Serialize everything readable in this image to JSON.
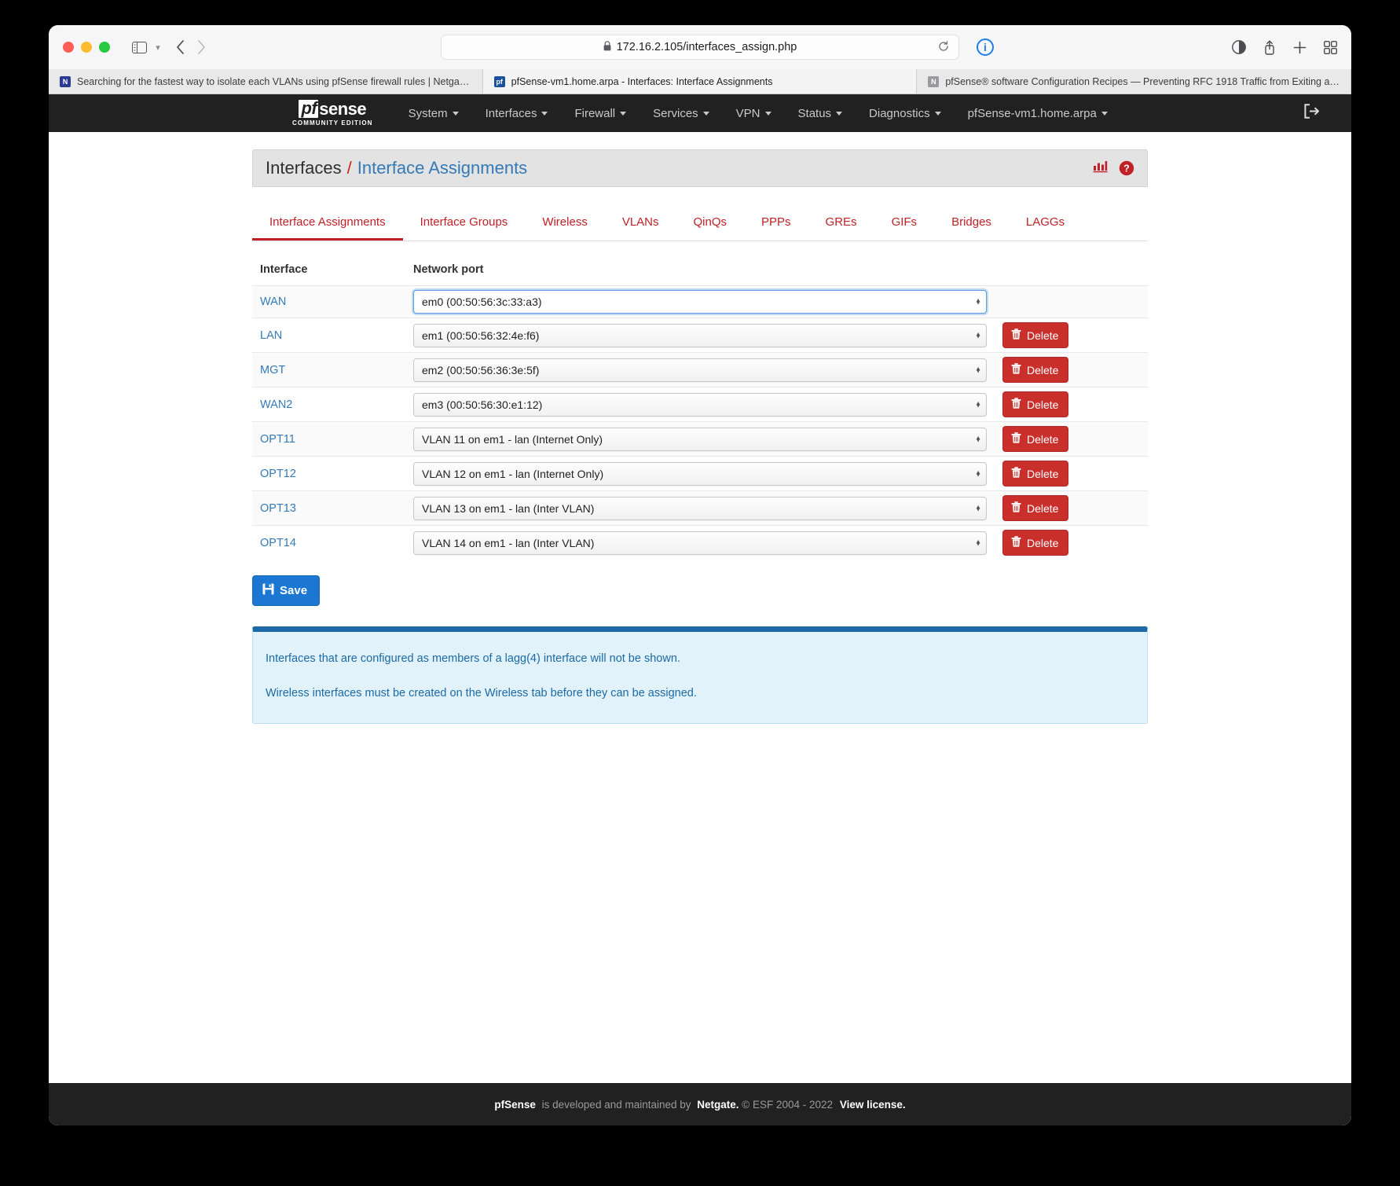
{
  "browser": {
    "url": "172.16.2.105/interfaces_assign.php",
    "lock_icon": "lock-icon",
    "reload_icon": "reload-icon",
    "info_badge": "i",
    "tabs": [
      {
        "title": "Searching for the fastest way to isolate each VLANs using pfSense firewall rules | Netgate For...",
        "favicon": "netgate-icon",
        "active": false
      },
      {
        "title": "pfSense-vm1.home.arpa - Interfaces: Interface Assignments",
        "favicon": "pfsense-icon",
        "active": true
      },
      {
        "title": "pfSense® software Configuration Recipes — Preventing RFC 1918 Traffic from Exiting a WAN I...",
        "favicon": "docs-icon",
        "active": false
      }
    ]
  },
  "navbar": {
    "brand": {
      "pf": "pf",
      "sense": "sense",
      "subtitle": "COMMUNITY EDITION"
    },
    "items": [
      {
        "label": "System",
        "has_caret": true
      },
      {
        "label": "Interfaces",
        "has_caret": true
      },
      {
        "label": "Firewall",
        "has_caret": true
      },
      {
        "label": "Services",
        "has_caret": true
      },
      {
        "label": "VPN",
        "has_caret": true
      },
      {
        "label": "Status",
        "has_caret": true
      },
      {
        "label": "Diagnostics",
        "has_caret": true
      },
      {
        "label": "pfSense-vm1.home.arpa",
        "has_caret": true
      }
    ],
    "logout_icon": "logout-icon"
  },
  "header": {
    "root": "Interfaces",
    "separator": "/",
    "leaf": "Interface Assignments",
    "chart_icon": "bar-chart-icon",
    "help_icon": "help-circle-icon"
  },
  "tabs": [
    {
      "label": "Interface Assignments",
      "active": true
    },
    {
      "label": "Interface Groups",
      "active": false
    },
    {
      "label": "Wireless",
      "active": false
    },
    {
      "label": "VLANs",
      "active": false
    },
    {
      "label": "QinQs",
      "active": false
    },
    {
      "label": "PPPs",
      "active": false
    },
    {
      "label": "GREs",
      "active": false
    },
    {
      "label": "GIFs",
      "active": false
    },
    {
      "label": "Bridges",
      "active": false
    },
    {
      "label": "LAGGs",
      "active": false
    }
  ],
  "table": {
    "columns": [
      "Interface",
      "Network port"
    ],
    "rows": [
      {
        "interface": "WAN",
        "port": "em0 (00:50:56:3c:33:a3)",
        "deletable": false,
        "focused": true
      },
      {
        "interface": "LAN",
        "port": "em1 (00:50:56:32:4e:f6)",
        "deletable": true,
        "focused": false
      },
      {
        "interface": "MGT",
        "port": "em2 (00:50:56:36:3e:5f)",
        "deletable": true,
        "focused": false
      },
      {
        "interface": "WAN2",
        "port": "em3 (00:50:56:30:e1:12)",
        "deletable": true,
        "focused": false
      },
      {
        "interface": "OPT11",
        "port": "VLAN 11 on em1 - lan (Internet Only)",
        "deletable": true,
        "focused": false
      },
      {
        "interface": "OPT12",
        "port": "VLAN 12 on em1 - lan (Internet Only)",
        "deletable": true,
        "focused": false
      },
      {
        "interface": "OPT13",
        "port": "VLAN 13 on em1 - lan (Inter VLAN)",
        "deletable": true,
        "focused": false
      },
      {
        "interface": "OPT14",
        "port": "VLAN 14 on em1 - lan (Inter VLAN)",
        "deletable": true,
        "focused": false
      }
    ],
    "delete_label": "Delete"
  },
  "save_button": {
    "label": "Save",
    "icon": "floppy-disk-icon"
  },
  "infobox": {
    "lines": [
      "Interfaces that are configured as members of a lagg(4) interface will not be shown.",
      "Wireless interfaces must be created on the Wireless tab before they can be assigned."
    ]
  },
  "footer": {
    "brand": "pfSense",
    "text_mid": " is developed and maintained by ",
    "maintainer": "Netgate.",
    "copyright": " © ESF 2004 - 2022 ",
    "license": "View license."
  },
  "colors": {
    "navbar_bg": "#212121",
    "accent_red": "#c02026",
    "link_blue": "#337ab7",
    "save_blue": "#1b77d2",
    "delete_red": "#c9302c",
    "info_bg": "#e2f2fb",
    "info_border": "#1b6aa5"
  }
}
